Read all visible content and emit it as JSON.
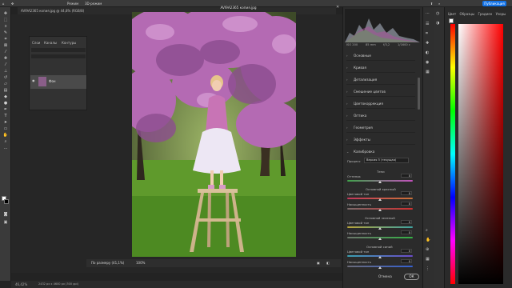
{
  "options_bar": {
    "mode_label": "Режим",
    "extra_label": "3D-режим",
    "publish_label": "Публикация"
  },
  "document": {
    "tab_title": "AVI9A2365 копия.jpg @ 44,8% (RGB/8)",
    "dialog_title": "AVI9A2365 копия.jpg",
    "status_zoom": "46,42%",
    "status_info": "2432 px x 4600 px (300 ppi)",
    "fit_label": "По размеру (41,1%)",
    "zoom_label": "100%"
  },
  "layers_panel": {
    "tabs": [
      "Слои",
      "Каналы",
      "Контуры"
    ],
    "layer_name": "Фон"
  },
  "camera_raw": {
    "histogram_info": [
      "ISO 200",
      "85 mm",
      "f/3,2",
      "1/1600 с"
    ],
    "sections": [
      "Основные",
      "Кривая",
      "Детализация",
      "Смешение цветов",
      "Цветокоррекция",
      "Оптика",
      "Геометрия",
      "Эффекты"
    ],
    "calibration": {
      "title": "Калибровка",
      "process_label": "Процесс",
      "process_value": "Версия 5 (текущая)",
      "shadows_title": "Тени",
      "shadows_tint_label": "Оттенок",
      "shadows_tint_value": "0",
      "red_title": "Основной красный",
      "red_hue_label": "Цветовой тон",
      "red_hue_value": "0",
      "red_sat_label": "Насыщенность",
      "red_sat_value": "0",
      "green_title": "Основной зеленый",
      "green_hue_label": "Цветовой тон",
      "green_hue_value": "0",
      "green_sat_label": "Насыщенность",
      "green_sat_value": "0",
      "blue_title": "Основной синий",
      "blue_hue_label": "Цветовой тон",
      "blue_hue_value": "0",
      "blue_sat_label": "Насыщенность",
      "blue_sat_value": "0"
    },
    "cancel_label": "Отмена",
    "ok_label": "ОК"
  },
  "color_panel": {
    "tabs": [
      "Цвет",
      "Образцы",
      "Градиен",
      "Узоры"
    ]
  },
  "colors": {
    "accent": "#1473e6",
    "panel_bg": "#2b2b2b"
  }
}
